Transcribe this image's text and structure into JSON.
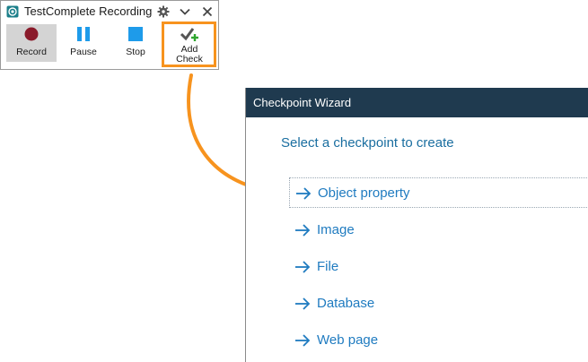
{
  "recording": {
    "title": "TestComplete Recording",
    "buttons": {
      "record": "Record",
      "pause": "Pause",
      "stop": "Stop",
      "add_check_line1": "Add",
      "add_check_line2": "Check"
    },
    "icons": [
      "app-icon",
      "gear-icon",
      "chevron-down-icon",
      "close-icon",
      "record-icon",
      "pause-icon",
      "stop-icon",
      "add-check-icon"
    ],
    "colors": {
      "record": "#8a1a2a",
      "accent": "#1e9bea",
      "highlight": "#f7931e"
    }
  },
  "wizard": {
    "title": "Checkpoint Wizard",
    "prompt": "Select a checkpoint to create",
    "options": [
      {
        "label": "Object property"
      },
      {
        "label": "Image"
      },
      {
        "label": "File"
      },
      {
        "label": "Database"
      },
      {
        "label": "Web page"
      }
    ],
    "colors": {
      "header": "#1f3a4f",
      "option": "#1f7bc0"
    }
  }
}
